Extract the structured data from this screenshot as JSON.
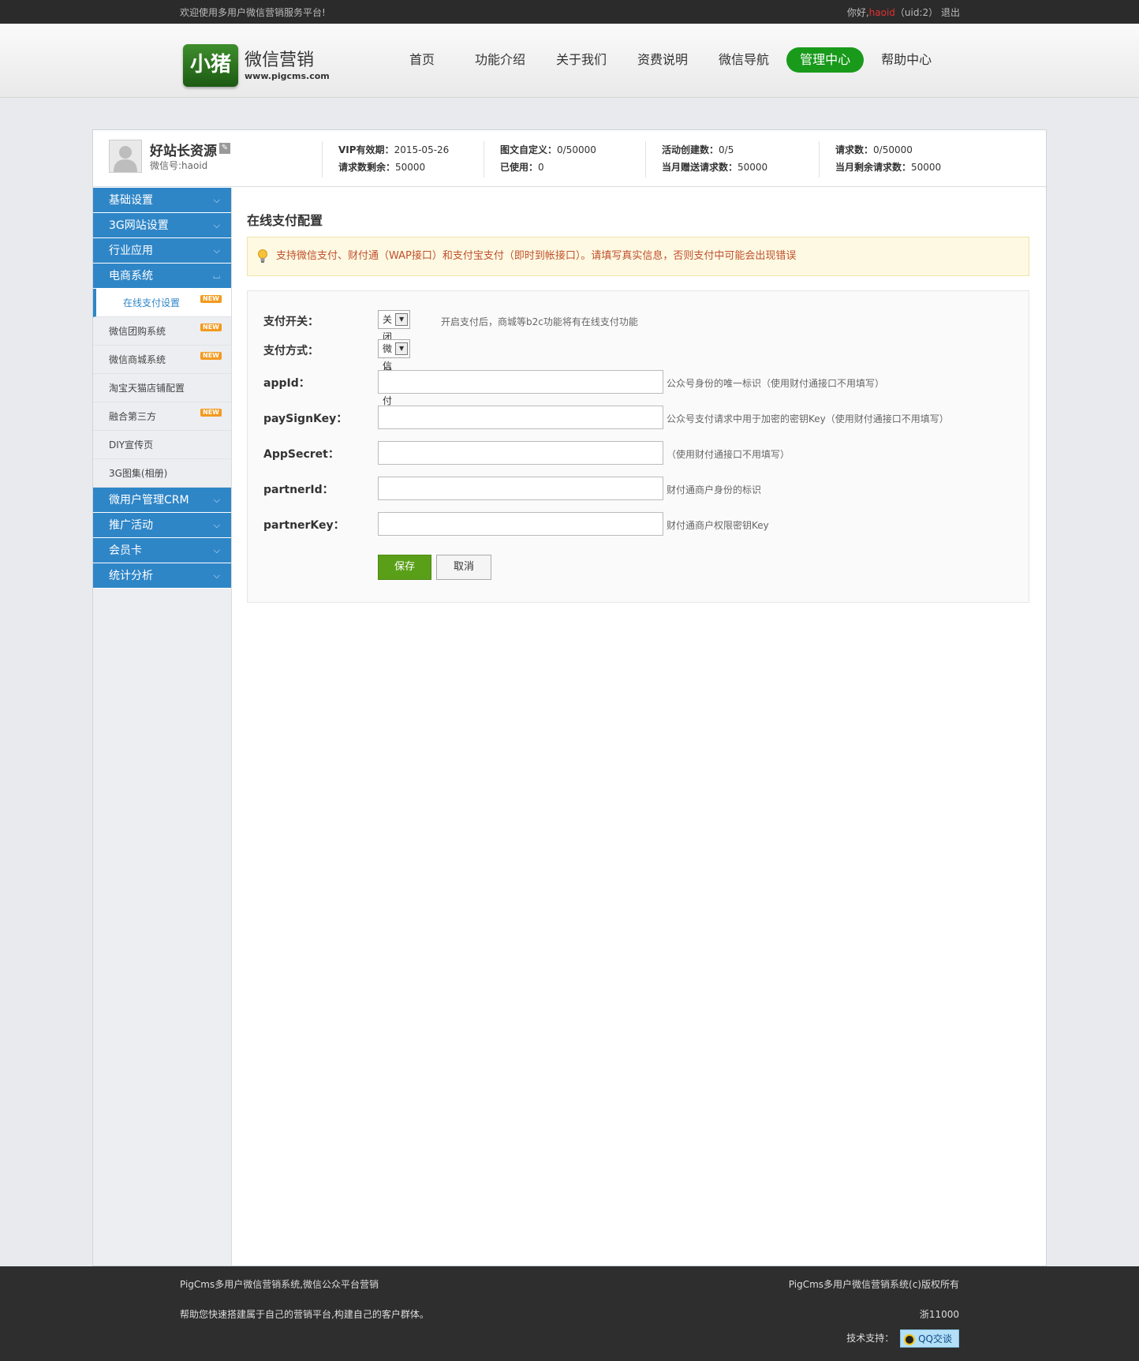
{
  "topbar": {
    "welcome": "欢迎使用多用户微信营销服务平台!",
    "greeting": "你好,",
    "username": "haoid",
    "uid": "（uid:2）",
    "logout": "退出"
  },
  "logo": {
    "badge": "小猪",
    "name": "微信营销",
    "url": "www.pigcms.com"
  },
  "nav": [
    "首页",
    "功能介绍",
    "关于我们",
    "资费说明",
    "微信导航",
    "管理中心",
    "帮助中心"
  ],
  "profile": {
    "name": "好站长资源",
    "wechat_id": "微信号:haoid",
    "stats": [
      {
        "l1_label": "VIP有效期：",
        "l1_value": "2015-05-26",
        "l2_label": "请求数剩余：",
        "l2_value": "50000"
      },
      {
        "l1_label": "图文自定义：",
        "l1_value": "0/50000",
        "l2_label": "已使用：",
        "l2_value": "0"
      },
      {
        "l1_label": "活动创建数：",
        "l1_value": "0/5",
        "l2_label": "当月赠送请求数：",
        "l2_value": "50000"
      },
      {
        "l1_label": "请求数：",
        "l1_value": "0/50000",
        "l2_label": "当月剩余请求数：",
        "l2_value": "50000"
      }
    ]
  },
  "sidebar": {
    "top_groups": [
      "基础设置",
      "3G网站设置",
      "行业应用",
      "电商系统"
    ],
    "sub_items": [
      {
        "label": "在线支付设置",
        "new": "NEW"
      },
      {
        "label": "微信团购系统",
        "new": "NEW"
      },
      {
        "label": "微信商城系统",
        "new": "NEW"
      },
      {
        "label": "淘宝天猫店铺配置",
        "new": ""
      },
      {
        "label": "融合第三方",
        "new": "NEW"
      },
      {
        "label": "DIY宣传页",
        "new": ""
      },
      {
        "label": "3G图集(相册)",
        "new": ""
      }
    ],
    "bottom_groups": [
      "微用户管理CRM",
      "推广活动",
      "会员卡",
      "统计分析"
    ]
  },
  "content": {
    "title": "在线支付配置",
    "notice": "支持微信支付、财付通（WAP接口）和支付宝支付（即时到帐接口）。请填写真实信息，否则支付中可能会出现错误",
    "switch": {
      "label": "支付开关：",
      "value": "关闭支付",
      "hint": "开启支付后，商城等b2c功能将有在线支付功能"
    },
    "method": {
      "label": "支付方式：",
      "value": "微信支付"
    },
    "fields": [
      {
        "label": "appId：",
        "value": "",
        "hint": "公众号身份的唯一标识（使用财付通接口不用填写）"
      },
      {
        "label": "paySignKey：",
        "value": "",
        "hint": "公众号支付请求中用于加密的密钥Key（使用财付通接口不用填写）"
      },
      {
        "label": "AppSecret：",
        "value": "",
        "hint": "（使用财付通接口不用填写）"
      },
      {
        "label": "partnerId：",
        "value": "",
        "hint": "财付通商户身份的标识"
      },
      {
        "label": "partnerKey：",
        "value": "",
        "hint": "财付通商户权限密钥Key"
      }
    ],
    "save": "保存",
    "cancel": "取消"
  },
  "footer": {
    "left1": "PigCms多用户微信营销系统,微信公众平台营销",
    "left2": "帮助您快速搭建属于自己的营销平台,构建自己的客户群体。",
    "right1": "PigCms多用户微信营销系统(c)版权所有",
    "right2": "浙11000",
    "support": "技术支持：",
    "qq": "QQ交谈"
  },
  "colors": {
    "nav_active": "#199a1b",
    "sidebar_head": "#2f86c7",
    "save_btn": "#5a9f18",
    "notice_text": "#c0512b"
  }
}
